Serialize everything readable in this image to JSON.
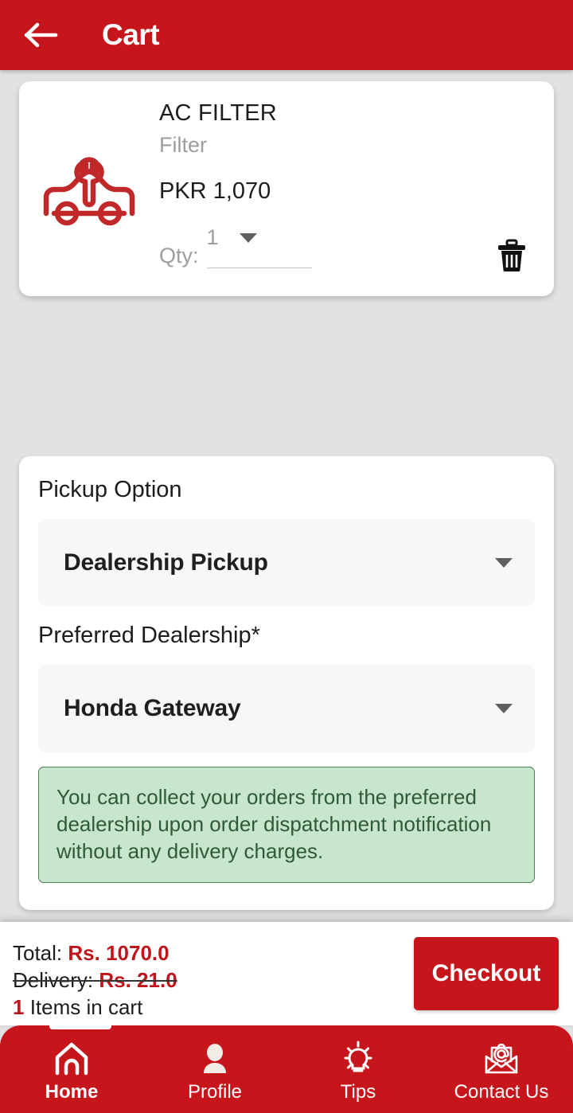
{
  "appbar": {
    "back_icon": "arrow-left-icon",
    "title": "Cart"
  },
  "cart_item": {
    "image_icon": "car-with-wrench-icon",
    "name": "AC FILTER",
    "category": "Filter",
    "price": "PKR 1,070",
    "qty_label": "Qty:",
    "qty_value": "1",
    "dropdown_icon": "chevron-down-icon",
    "delete_icon": "trash-icon"
  },
  "pickup": {
    "section_label": "Pickup Option",
    "option_value": "Dealership Pickup",
    "dealership_label": "Preferred Dealership*",
    "dealership_value": "Honda Gateway",
    "notice": "You can collect your orders from the preferred dealership upon order dispatchment notification without any delivery charges."
  },
  "summary": {
    "total_label": "Total:",
    "total_value": "Rs. 1070.0",
    "delivery_label": "Delivery:",
    "delivery_value": "Rs. 21.0",
    "items_count": "1",
    "items_label": "Items in cart",
    "checkout_label": "Checkout"
  },
  "bottom_nav": {
    "items": [
      {
        "label": "Home",
        "icon": "home-icon"
      },
      {
        "label": "Profile",
        "icon": "person-icon"
      },
      {
        "label": "Tips",
        "icon": "lightbulb-icon"
      },
      {
        "label": "Contact Us",
        "icon": "envelope-at-icon"
      }
    ]
  },
  "colors": {
    "brand_red": "#c6161c",
    "accent_red": "#c0141b",
    "page_bg": "#e1e1e1",
    "notice_bg": "#c7e6cc",
    "notice_border": "#4f7d57",
    "notice_text": "#2f5a39"
  }
}
